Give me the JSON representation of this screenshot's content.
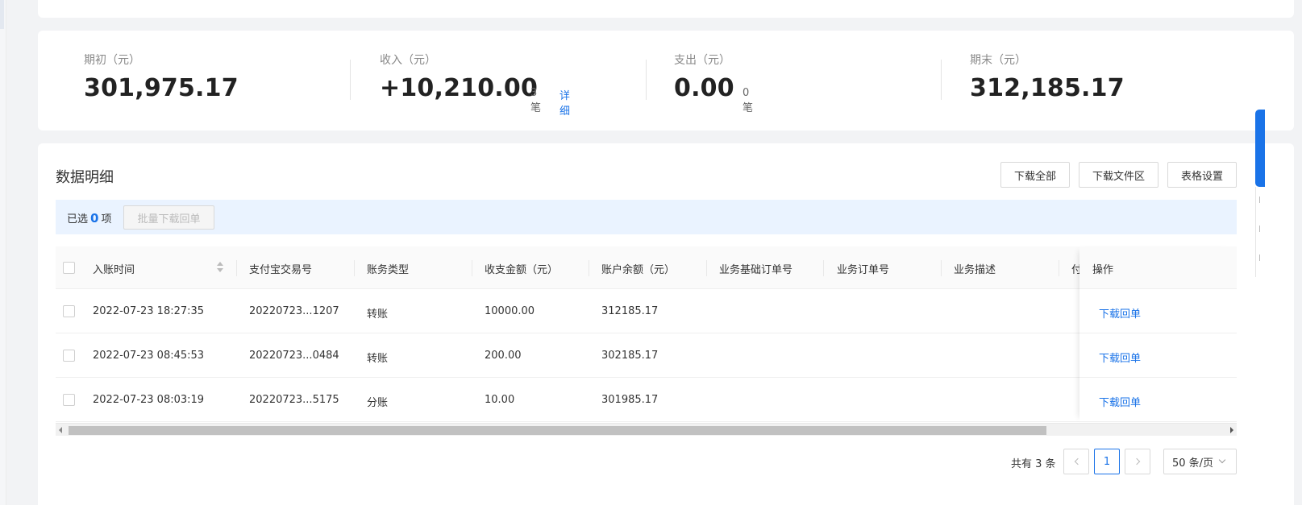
{
  "summary": {
    "opening": {
      "label": "期初（元）",
      "value": "301,975.17"
    },
    "income": {
      "label": "收入（元）",
      "value": "+10,210.00",
      "count": "3笔",
      "detail": "详细"
    },
    "expense": {
      "label": "支出（元）",
      "value": "0.00",
      "count": "0笔"
    },
    "closing": {
      "label": "期末（元）",
      "value": "312,185.17"
    }
  },
  "detail": {
    "title": "数据明细",
    "buttons": {
      "download_all": "下载全部",
      "download_area": "下载文件区",
      "table_settings": "表格设置"
    },
    "selection": {
      "prefix": "已选",
      "count": "0",
      "suffix": "项",
      "batch_button": "批量下载回单"
    }
  },
  "table": {
    "columns": [
      "入账时间",
      "支付宝交易号",
      "账务类型",
      "收支金额（元）",
      "账户余额（元）",
      "业务基础订单号",
      "业务订单号",
      "业务描述",
      "付"
    ],
    "action_column": "操作",
    "rows": [
      {
        "time": "2022-07-23 18:27:35",
        "trade_no": "20220723...1207",
        "type": "转账",
        "amount": "10000.00",
        "balance": "312185.17",
        "action": "下载回单"
      },
      {
        "time": "2022-07-23 08:45:53",
        "trade_no": "20220723...0484",
        "type": "转账",
        "amount": "200.00",
        "balance": "302185.17",
        "action": "下载回单"
      },
      {
        "time": "2022-07-23 08:03:19",
        "trade_no": "20220723...5175",
        "type": "分账",
        "amount": "10.00",
        "balance": "301985.17",
        "action": "下载回单"
      }
    ]
  },
  "pagination": {
    "total": "共有 3 条",
    "current_page": "1",
    "page_size": "50 条/页"
  },
  "colors": {
    "accent": "#1a73e8",
    "select_bar": "#eaf3ff"
  }
}
